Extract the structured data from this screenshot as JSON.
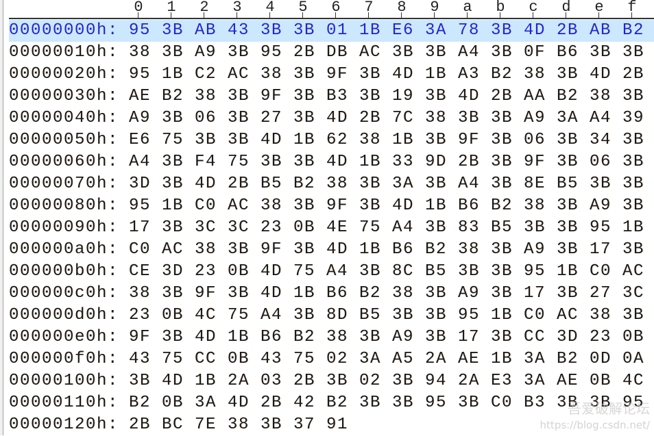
{
  "header": {
    "columns": [
      "0",
      "1",
      "2",
      "3",
      "4",
      "5",
      "6",
      "7",
      "8",
      "9",
      "a",
      "b",
      "c",
      "d",
      "e",
      "f"
    ]
  },
  "selected_row": 0,
  "colors": {
    "selection_bg": "#cce8ff",
    "selection_text": "#2424d0",
    "text": "#1a1a1a"
  },
  "rows": [
    {
      "addr": "00000000h:",
      "bytes": [
        "95",
        "3B",
        "AB",
        "43",
        "3B",
        "3B",
        "01",
        "1B",
        "E6",
        "3A",
        "78",
        "3B",
        "4D",
        "2B",
        "AB",
        "B2"
      ]
    },
    {
      "addr": "00000010h:",
      "bytes": [
        "38",
        "3B",
        "A9",
        "3B",
        "95",
        "2B",
        "DB",
        "AC",
        "3B",
        "3B",
        "A4",
        "3B",
        "0F",
        "B6",
        "3B",
        "3B"
      ]
    },
    {
      "addr": "00000020h:",
      "bytes": [
        "95",
        "1B",
        "C2",
        "AC",
        "38",
        "3B",
        "9F",
        "3B",
        "4D",
        "1B",
        "A3",
        "B2",
        "38",
        "3B",
        "4D",
        "2B"
      ]
    },
    {
      "addr": "00000030h:",
      "bytes": [
        "AE",
        "B2",
        "38",
        "3B",
        "9F",
        "3B",
        "B3",
        "3B",
        "19",
        "3B",
        "4D",
        "2B",
        "AA",
        "B2",
        "38",
        "3B"
      ]
    },
    {
      "addr": "00000040h:",
      "bytes": [
        "A9",
        "3B",
        "06",
        "3B",
        "27",
        "3B",
        "4D",
        "2B",
        "7C",
        "38",
        "3B",
        "3B",
        "A9",
        "3A",
        "A4",
        "39"
      ]
    },
    {
      "addr": "00000050h:",
      "bytes": [
        "E6",
        "75",
        "3B",
        "3B",
        "4D",
        "1B",
        "62",
        "38",
        "1B",
        "3B",
        "9F",
        "3B",
        "06",
        "3B",
        "34",
        "3B"
      ]
    },
    {
      "addr": "00000060h:",
      "bytes": [
        "A4",
        "3B",
        "F4",
        "75",
        "3B",
        "3B",
        "4D",
        "1B",
        "33",
        "9D",
        "2B",
        "3B",
        "9F",
        "3B",
        "06",
        "3B"
      ]
    },
    {
      "addr": "00000070h:",
      "bytes": [
        "3D",
        "3B",
        "4D",
        "2B",
        "B5",
        "B2",
        "38",
        "3B",
        "3A",
        "3B",
        "A4",
        "3B",
        "8E",
        "B5",
        "3B",
        "3B"
      ]
    },
    {
      "addr": "00000080h:",
      "bytes": [
        "95",
        "1B",
        "C0",
        "AC",
        "38",
        "3B",
        "9F",
        "3B",
        "4D",
        "1B",
        "B6",
        "B2",
        "38",
        "3B",
        "A9",
        "3B"
      ]
    },
    {
      "addr": "00000090h:",
      "bytes": [
        "17",
        "3B",
        "3C",
        "3C",
        "23",
        "0B",
        "4E",
        "75",
        "A4",
        "3B",
        "83",
        "B5",
        "3B",
        "3B",
        "95",
        "1B"
      ]
    },
    {
      "addr": "000000a0h:",
      "bytes": [
        "C0",
        "AC",
        "38",
        "3B",
        "9F",
        "3B",
        "4D",
        "1B",
        "B6",
        "B2",
        "38",
        "3B",
        "A9",
        "3B",
        "17",
        "3B"
      ]
    },
    {
      "addr": "000000b0h:",
      "bytes": [
        "CE",
        "3D",
        "23",
        "0B",
        "4D",
        "75",
        "A4",
        "3B",
        "8C",
        "B5",
        "3B",
        "3B",
        "95",
        "1B",
        "C0",
        "AC"
      ]
    },
    {
      "addr": "000000c0h:",
      "bytes": [
        "38",
        "3B",
        "9F",
        "3B",
        "4D",
        "1B",
        "B6",
        "B2",
        "38",
        "3B",
        "A9",
        "3B",
        "17",
        "3B",
        "27",
        "3C"
      ]
    },
    {
      "addr": "000000d0h:",
      "bytes": [
        "23",
        "0B",
        "4C",
        "75",
        "A4",
        "3B",
        "8D",
        "B5",
        "3B",
        "3B",
        "95",
        "1B",
        "C0",
        "AC",
        "38",
        "3B"
      ]
    },
    {
      "addr": "000000e0h:",
      "bytes": [
        "9F",
        "3B",
        "4D",
        "1B",
        "B6",
        "B2",
        "38",
        "3B",
        "A9",
        "3B",
        "17",
        "3B",
        "CC",
        "3D",
        "23",
        "0B"
      ]
    },
    {
      "addr": "000000f0h:",
      "bytes": [
        "43",
        "75",
        "CC",
        "0B",
        "43",
        "75",
        "02",
        "3A",
        "A5",
        "2A",
        "AE",
        "1B",
        "3A",
        "B2",
        "0D",
        "0A"
      ]
    },
    {
      "addr": "00000100h:",
      "bytes": [
        "3B",
        "4D",
        "1B",
        "2A",
        "03",
        "2B",
        "3B",
        "02",
        "3B",
        "94",
        "2A",
        "E3",
        "3A",
        "AE",
        "0B",
        "4C"
      ]
    },
    {
      "addr": "00000110h:",
      "bytes": [
        "B2",
        "0B",
        "3A",
        "4D",
        "2B",
        "42",
        "B2",
        "3B",
        "3B",
        "95",
        "3B",
        "C0",
        "B3",
        "3B",
        "3B",
        "95"
      ]
    },
    {
      "addr": "00000120h:",
      "bytes": [
        "2B",
        "BC",
        "7E",
        "38",
        "3B",
        "37",
        "91"
      ]
    }
  ],
  "watermark": {
    "text": "吾爱破解论坛",
    "url": "https://blog.csdn.net/"
  }
}
